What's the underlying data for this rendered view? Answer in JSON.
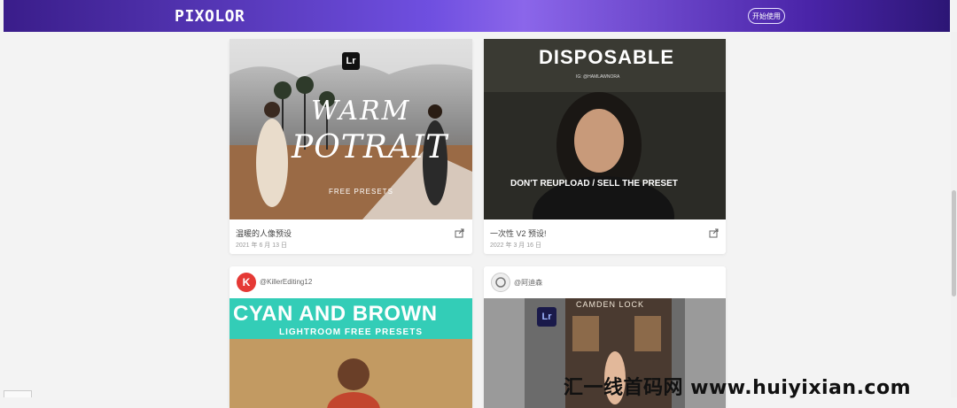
{
  "header": {
    "logo": "PIXOLOR",
    "start_button": "开始使用",
    "accent": "#6f4fe0"
  },
  "cards": [
    {
      "image_text": {
        "main1": "WARM",
        "main2": "POTRAIT",
        "sub": "FREE PRESETS",
        "badge": "Lr"
      },
      "title": "温暖的人像预设",
      "date": "2021 年 6 月 13 日",
      "share_icon": "share-icon"
    },
    {
      "image_text": {
        "main": "DISPOSABLE",
        "handle": "IG: @HAMLAWNORA",
        "caption": "DON'T REUPLOAD / SELL THE PRESET"
      },
      "title": "一次性 V2 预设!",
      "date": "2022 年 3 月 16 日",
      "share_icon": "share-icon"
    },
    {
      "author": "@KillerEditing12",
      "avatar_letter": "K",
      "image_text": {
        "main": "CYAN AND BROWN",
        "sub": "LIGHTROOM FREE PRESETS"
      }
    },
    {
      "author": "@阿迪森",
      "image_text": {
        "sign": "CAMDEN LOCK",
        "badge": "Lr"
      }
    }
  ],
  "watermark": "汇一线首码网 www.huiyixian.com"
}
